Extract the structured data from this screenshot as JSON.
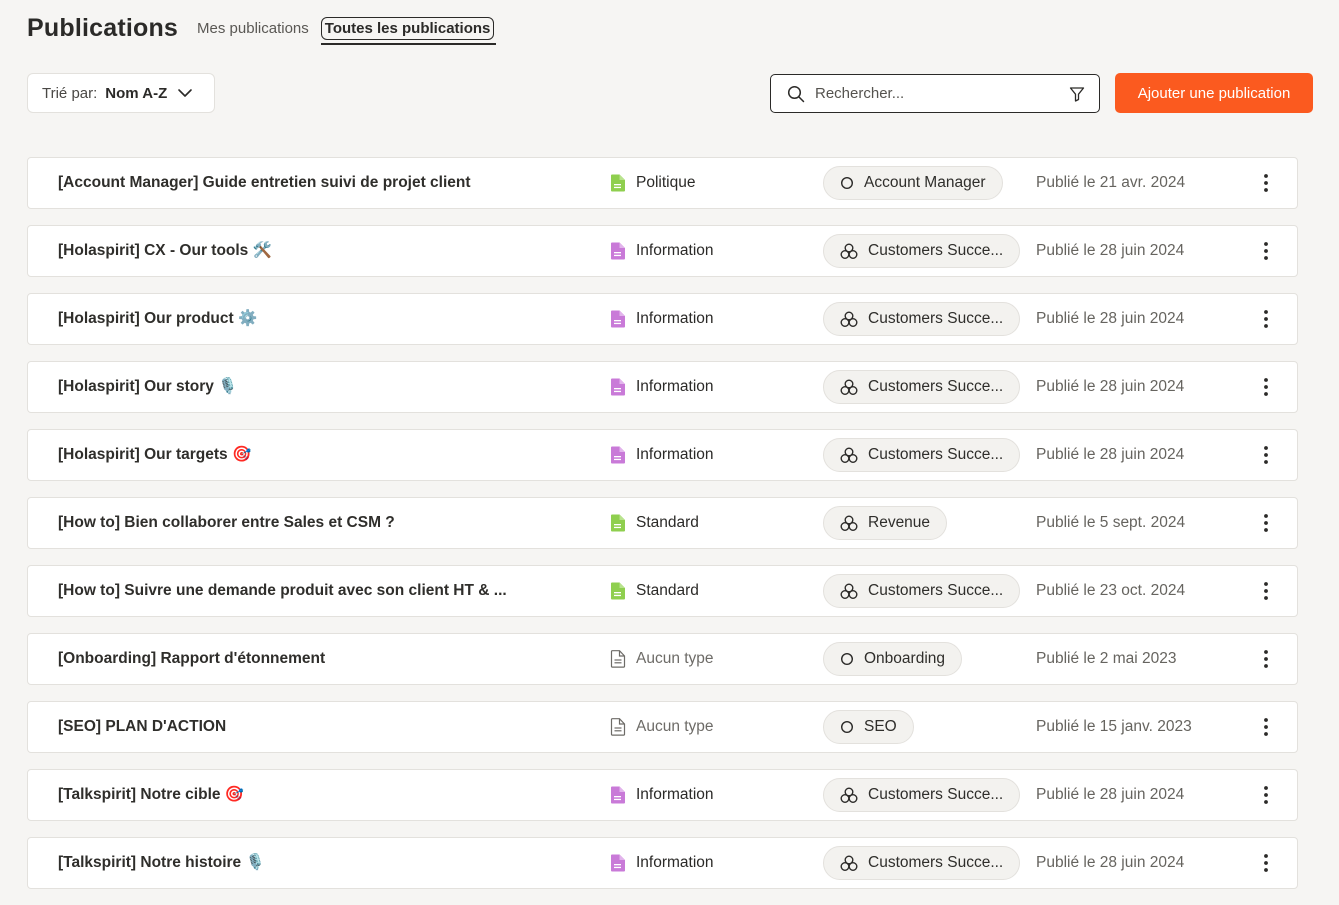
{
  "page": {
    "title": "Publications"
  },
  "tabs": [
    {
      "label": "Mes publications",
      "active": false
    },
    {
      "label": "Toutes les publications",
      "active": true
    }
  ],
  "sort": {
    "label": "Trié par:",
    "value": "Nom A-Z"
  },
  "search": {
    "placeholder": "Rechercher..."
  },
  "add_button": {
    "label": "Ajouter une publication"
  },
  "colors": {
    "accent": "#fb5a1f",
    "politique_icon": "#8fcf4f",
    "standard_icon": "#8fcf4f",
    "information_icon": "#c97ad8",
    "none_icon": "#6d6b67"
  },
  "rows": [
    {
      "title": "[Account Manager] Guide entretien suivi de projet client",
      "type": "Politique",
      "type_icon": "green-document-icon",
      "circle": "Account Manager",
      "circle_icon": "role-circle-icon",
      "date": "Publié le 21 avr. 2024"
    },
    {
      "title": "[Holaspirit] CX - Our tools 🛠️",
      "type": "Information",
      "type_icon": "purple-document-icon",
      "circle": "Customers Succe...",
      "circle_icon": "circle-group-icon",
      "date": "Publié le 28 juin 2024"
    },
    {
      "title": "[Holaspirit] Our product ⚙️",
      "type": "Information",
      "type_icon": "purple-document-icon",
      "circle": "Customers Succe...",
      "circle_icon": "circle-group-icon",
      "date": "Publié le 28 juin 2024"
    },
    {
      "title": "[Holaspirit] Our story 🎙️",
      "type": "Information",
      "type_icon": "purple-document-icon",
      "circle": "Customers Succe...",
      "circle_icon": "circle-group-icon",
      "date": "Publié le 28 juin 2024"
    },
    {
      "title": "[Holaspirit] Our targets 🎯",
      "type": "Information",
      "type_icon": "purple-document-icon",
      "circle": "Customers Succe...",
      "circle_icon": "circle-group-icon",
      "date": "Publié le 28 juin 2024"
    },
    {
      "title": "[How to] Bien collaborer entre Sales et CSM ?",
      "type": "Standard",
      "type_icon": "green-document-icon",
      "circle": "Revenue",
      "circle_icon": "circle-group-icon",
      "date": "Publié le 5 sept. 2024"
    },
    {
      "title": "[How to] Suivre une demande produit avec son client HT & ...",
      "type": "Standard",
      "type_icon": "green-document-icon",
      "circle": "Customers Succe...",
      "circle_icon": "circle-group-icon",
      "date": "Publié le 23 oct. 2024"
    },
    {
      "title": "[Onboarding] Rapport d'étonnement",
      "type": "Aucun type",
      "type_icon": "outline-document-icon",
      "circle": "Onboarding",
      "circle_icon": "role-circle-icon",
      "date": "Publié le 2 mai 2023"
    },
    {
      "title": "[SEO] PLAN D'ACTION",
      "type": "Aucun type",
      "type_icon": "outline-document-icon",
      "circle": "SEO",
      "circle_icon": "role-circle-icon",
      "date": "Publié le 15 janv. 2023"
    },
    {
      "title": "[Talkspirit] Notre cible 🎯",
      "type": "Information",
      "type_icon": "purple-document-icon",
      "circle": "Customers Succe...",
      "circle_icon": "circle-group-icon",
      "date": "Publié le 28 juin 2024"
    },
    {
      "title": "[Talkspirit] Notre histoire 🎙️",
      "type": "Information",
      "type_icon": "purple-document-icon",
      "circle": "Customers Succe...",
      "circle_icon": "circle-group-icon",
      "date": "Publié le 28 juin 2024"
    }
  ]
}
